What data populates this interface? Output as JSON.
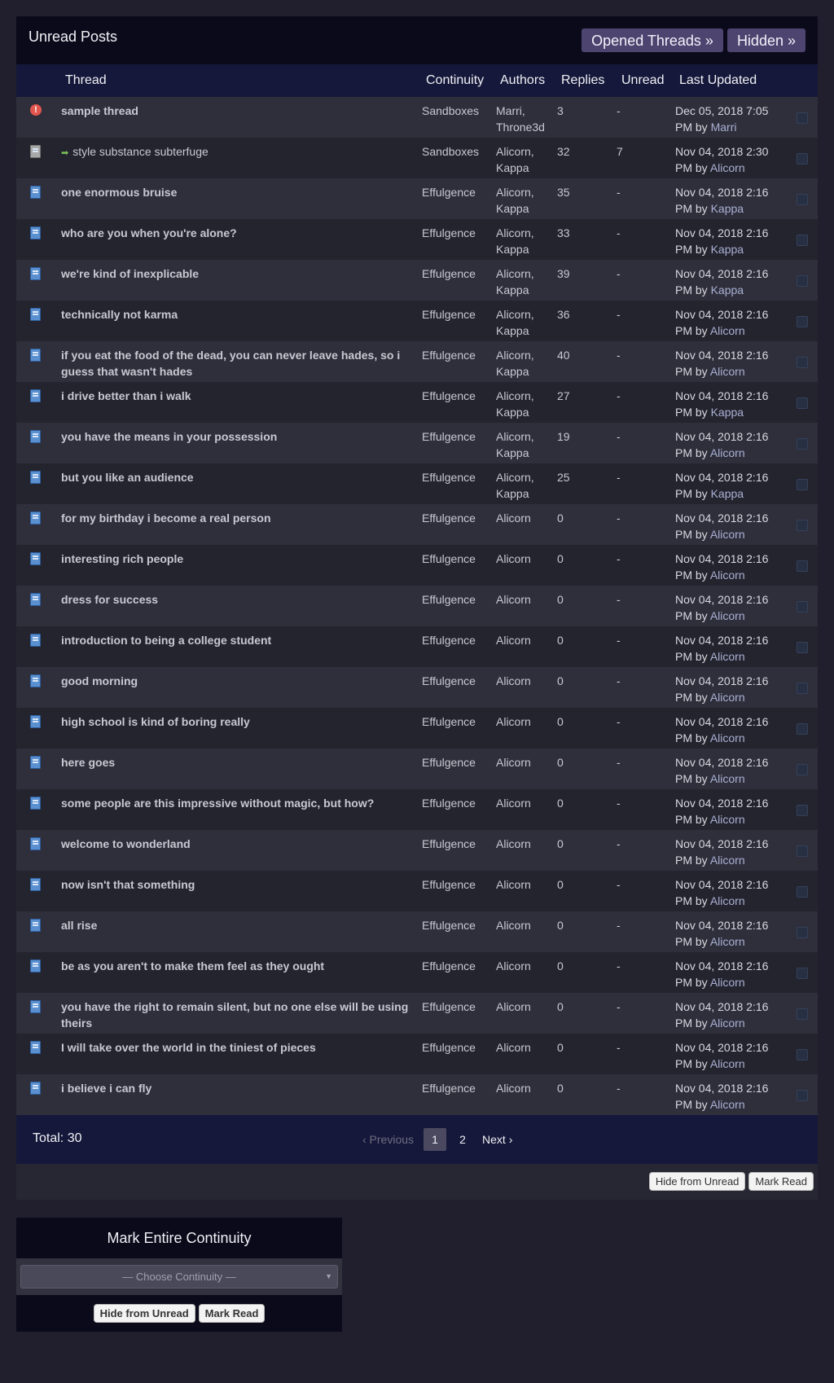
{
  "header": {
    "title": "Unread Posts",
    "opened_label": "Opened Threads »",
    "hidden_label": "Hidden »"
  },
  "columns": {
    "thread": "Thread",
    "continuity": "Continuity",
    "authors": "Authors",
    "replies": "Replies",
    "unread": "Unread",
    "last_updated": "Last Updated"
  },
  "rows": [
    {
      "icon": "alert-icon",
      "title": "sample thread",
      "continuity": "Sandboxes",
      "authors": "Marri, Throne3d",
      "replies": "3",
      "unread": "-",
      "date": "Dec 05, 2018 7:05 PM",
      "by": "Marri",
      "bold": true
    },
    {
      "icon": "gray-book-icon",
      "arrow": true,
      "title": "style substance subterfuge",
      "continuity": "Sandboxes",
      "authors": "Alicorn, Kappa",
      "replies": "32",
      "unread": "7",
      "date": "Nov 04, 2018 2:30 PM",
      "by": "Alicorn",
      "bold": false
    },
    {
      "icon": "book-icon",
      "title": "one enormous bruise",
      "continuity": "Effulgence",
      "authors": "Alicorn, Kappa",
      "replies": "35",
      "unread": "-",
      "date": "Nov 04, 2018 2:16 PM",
      "by": "Kappa",
      "bold": true
    },
    {
      "icon": "book-icon",
      "title": "who are you when you're alone?",
      "continuity": "Effulgence",
      "authors": "Alicorn, Kappa",
      "replies": "33",
      "unread": "-",
      "date": "Nov 04, 2018 2:16 PM",
      "by": "Kappa",
      "bold": true
    },
    {
      "icon": "book-icon",
      "title": "we're kind of inexplicable",
      "continuity": "Effulgence",
      "authors": "Alicorn, Kappa",
      "replies": "39",
      "unread": "-",
      "date": "Nov 04, 2018 2:16 PM",
      "by": "Kappa",
      "bold": true
    },
    {
      "icon": "book-icon",
      "title": "technically not karma",
      "continuity": "Effulgence",
      "authors": "Alicorn, Kappa",
      "replies": "36",
      "unread": "-",
      "date": "Nov 04, 2018 2:16 PM",
      "by": "Alicorn",
      "bold": true
    },
    {
      "icon": "book-icon",
      "title": "if you eat the food of the dead, you can never leave hades, so i guess that wasn't hades",
      "continuity": "Effulgence",
      "authors": "Alicorn, Kappa",
      "replies": "40",
      "unread": "-",
      "date": "Nov 04, 2018 2:16 PM",
      "by": "Alicorn",
      "bold": true
    },
    {
      "icon": "book-icon",
      "title": "i drive better than i walk",
      "continuity": "Effulgence",
      "authors": "Alicorn, Kappa",
      "replies": "27",
      "unread": "-",
      "date": "Nov 04, 2018 2:16 PM",
      "by": "Kappa",
      "bold": true
    },
    {
      "icon": "book-icon",
      "title": "you have the means in your possession",
      "continuity": "Effulgence",
      "authors": "Alicorn, Kappa",
      "replies": "19",
      "unread": "-",
      "date": "Nov 04, 2018 2:16 PM",
      "by": "Alicorn",
      "bold": true
    },
    {
      "icon": "book-icon",
      "title": "but you like an audience",
      "continuity": "Effulgence",
      "authors": "Alicorn, Kappa",
      "replies": "25",
      "unread": "-",
      "date": "Nov 04, 2018 2:16 PM",
      "by": "Kappa",
      "bold": true
    },
    {
      "icon": "book-icon",
      "title": "for my birthday i become a real person",
      "continuity": "Effulgence",
      "authors": "Alicorn",
      "replies": "0",
      "unread": "-",
      "date": "Nov 04, 2018 2:16 PM",
      "by": "Alicorn",
      "bold": true
    },
    {
      "icon": "book-icon",
      "title": "interesting rich people",
      "continuity": "Effulgence",
      "authors": "Alicorn",
      "replies": "0",
      "unread": "-",
      "date": "Nov 04, 2018 2:16 PM",
      "by": "Alicorn",
      "bold": true
    },
    {
      "icon": "book-icon",
      "title": "dress for success",
      "continuity": "Effulgence",
      "authors": "Alicorn",
      "replies": "0",
      "unread": "-",
      "date": "Nov 04, 2018 2:16 PM",
      "by": "Alicorn",
      "bold": true
    },
    {
      "icon": "book-icon",
      "title": "introduction to being a college student",
      "continuity": "Effulgence",
      "authors": "Alicorn",
      "replies": "0",
      "unread": "-",
      "date": "Nov 04, 2018 2:16 PM",
      "by": "Alicorn",
      "bold": true
    },
    {
      "icon": "book-icon",
      "title": "good morning",
      "continuity": "Effulgence",
      "authors": "Alicorn",
      "replies": "0",
      "unread": "-",
      "date": "Nov 04, 2018 2:16 PM",
      "by": "Alicorn",
      "bold": true
    },
    {
      "icon": "book-icon",
      "title": "high school is kind of boring really",
      "continuity": "Effulgence",
      "authors": "Alicorn",
      "replies": "0",
      "unread": "-",
      "date": "Nov 04, 2018 2:16 PM",
      "by": "Alicorn",
      "bold": true
    },
    {
      "icon": "book-icon",
      "title": "here goes",
      "continuity": "Effulgence",
      "authors": "Alicorn",
      "replies": "0",
      "unread": "-",
      "date": "Nov 04, 2018 2:16 PM",
      "by": "Alicorn",
      "bold": true
    },
    {
      "icon": "book-icon",
      "title": "some people are this impressive without magic, but how?",
      "continuity": "Effulgence",
      "authors": "Alicorn",
      "replies": "0",
      "unread": "-",
      "date": "Nov 04, 2018 2:16 PM",
      "by": "Alicorn",
      "bold": true
    },
    {
      "icon": "book-icon",
      "title": "welcome to wonderland",
      "continuity": "Effulgence",
      "authors": "Alicorn",
      "replies": "0",
      "unread": "-",
      "date": "Nov 04, 2018 2:16 PM",
      "by": "Alicorn",
      "bold": true
    },
    {
      "icon": "book-icon",
      "title": "now isn't that something",
      "continuity": "Effulgence",
      "authors": "Alicorn",
      "replies": "0",
      "unread": "-",
      "date": "Nov 04, 2018 2:16 PM",
      "by": "Alicorn",
      "bold": true
    },
    {
      "icon": "book-icon",
      "title": "all rise",
      "continuity": "Effulgence",
      "authors": "Alicorn",
      "replies": "0",
      "unread": "-",
      "date": "Nov 04, 2018 2:16 PM",
      "by": "Alicorn",
      "bold": true
    },
    {
      "icon": "book-icon",
      "title": "be as you aren't to make them feel as they ought",
      "continuity": "Effulgence",
      "authors": "Alicorn",
      "replies": "0",
      "unread": "-",
      "date": "Nov 04, 2018 2:16 PM",
      "by": "Alicorn",
      "bold": true
    },
    {
      "icon": "book-icon",
      "title": "you have the right to remain silent, but no one else will be using theirs",
      "continuity": "Effulgence",
      "authors": "Alicorn",
      "replies": "0",
      "unread": "-",
      "date": "Nov 04, 2018 2:16 PM",
      "by": "Alicorn",
      "bold": true
    },
    {
      "icon": "book-icon",
      "title": "I will take over the world in the tiniest of pieces",
      "continuity": "Effulgence",
      "authors": "Alicorn",
      "replies": "0",
      "unread": "-",
      "date": "Nov 04, 2018 2:16 PM",
      "by": "Alicorn",
      "bold": true
    },
    {
      "icon": "book-icon",
      "title": "i believe i can fly",
      "continuity": "Effulgence",
      "authors": "Alicorn",
      "replies": "0",
      "unread": "-",
      "date": "Nov 04, 2018 2:16 PM",
      "by": "Alicorn",
      "bold": true
    }
  ],
  "by_word": "by",
  "footer": {
    "total": "Total: 30",
    "prev": "‹ Previous",
    "page_current": "1",
    "page_2": "2",
    "next": "Next ›"
  },
  "actions": {
    "hide_label": "Hide from Unread",
    "mark_label": "Mark Read"
  },
  "mark_continuity": {
    "title": "Mark Entire Continuity",
    "select_placeholder": "— Choose Continuity —",
    "hide_label": "Hide from Unread",
    "mark_label": "Mark Read"
  }
}
